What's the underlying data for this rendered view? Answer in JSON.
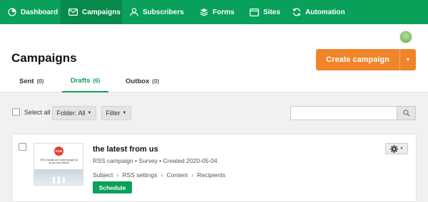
{
  "nav": {
    "items": [
      {
        "label": "Dashboard",
        "icon": "dashboard-icon"
      },
      {
        "label": "Campaigns",
        "icon": "envelope-icon"
      },
      {
        "label": "Subscribers",
        "icon": "user-icon"
      },
      {
        "label": "Forms",
        "icon": "forms-icon"
      },
      {
        "label": "Sites",
        "icon": "browser-window-icon"
      },
      {
        "label": "Automation",
        "icon": "automation-icon"
      }
    ],
    "active": "Campaigns"
  },
  "header": {
    "title": "Campaigns",
    "create_label": "Create campaign"
  },
  "tabs": [
    {
      "label": "Sent",
      "count": "(0)"
    },
    {
      "label": "Drafts",
      "count": "(6)"
    },
    {
      "label": "Outbox",
      "count": "(0)"
    }
  ],
  "toolbar": {
    "select_all_label": "Select all",
    "folder_label": "Folder: All",
    "filter_label": "Filter",
    "search_placeholder": ""
  },
  "campaign": {
    "title": "the latest from us",
    "meta": "RSS campaign • Survey • Created 2020-05-04",
    "steps": [
      "Subject",
      "RSS settings",
      "Content",
      "Recipients"
    ],
    "schedule_label": "Schedule",
    "thumbnail": {
      "logo_text": "FUN",
      "text": "90% of adults don't know enough fun, do you one of them?"
    }
  },
  "colors": {
    "brand_green": "#09a059",
    "accent_orange": "#f08429"
  }
}
